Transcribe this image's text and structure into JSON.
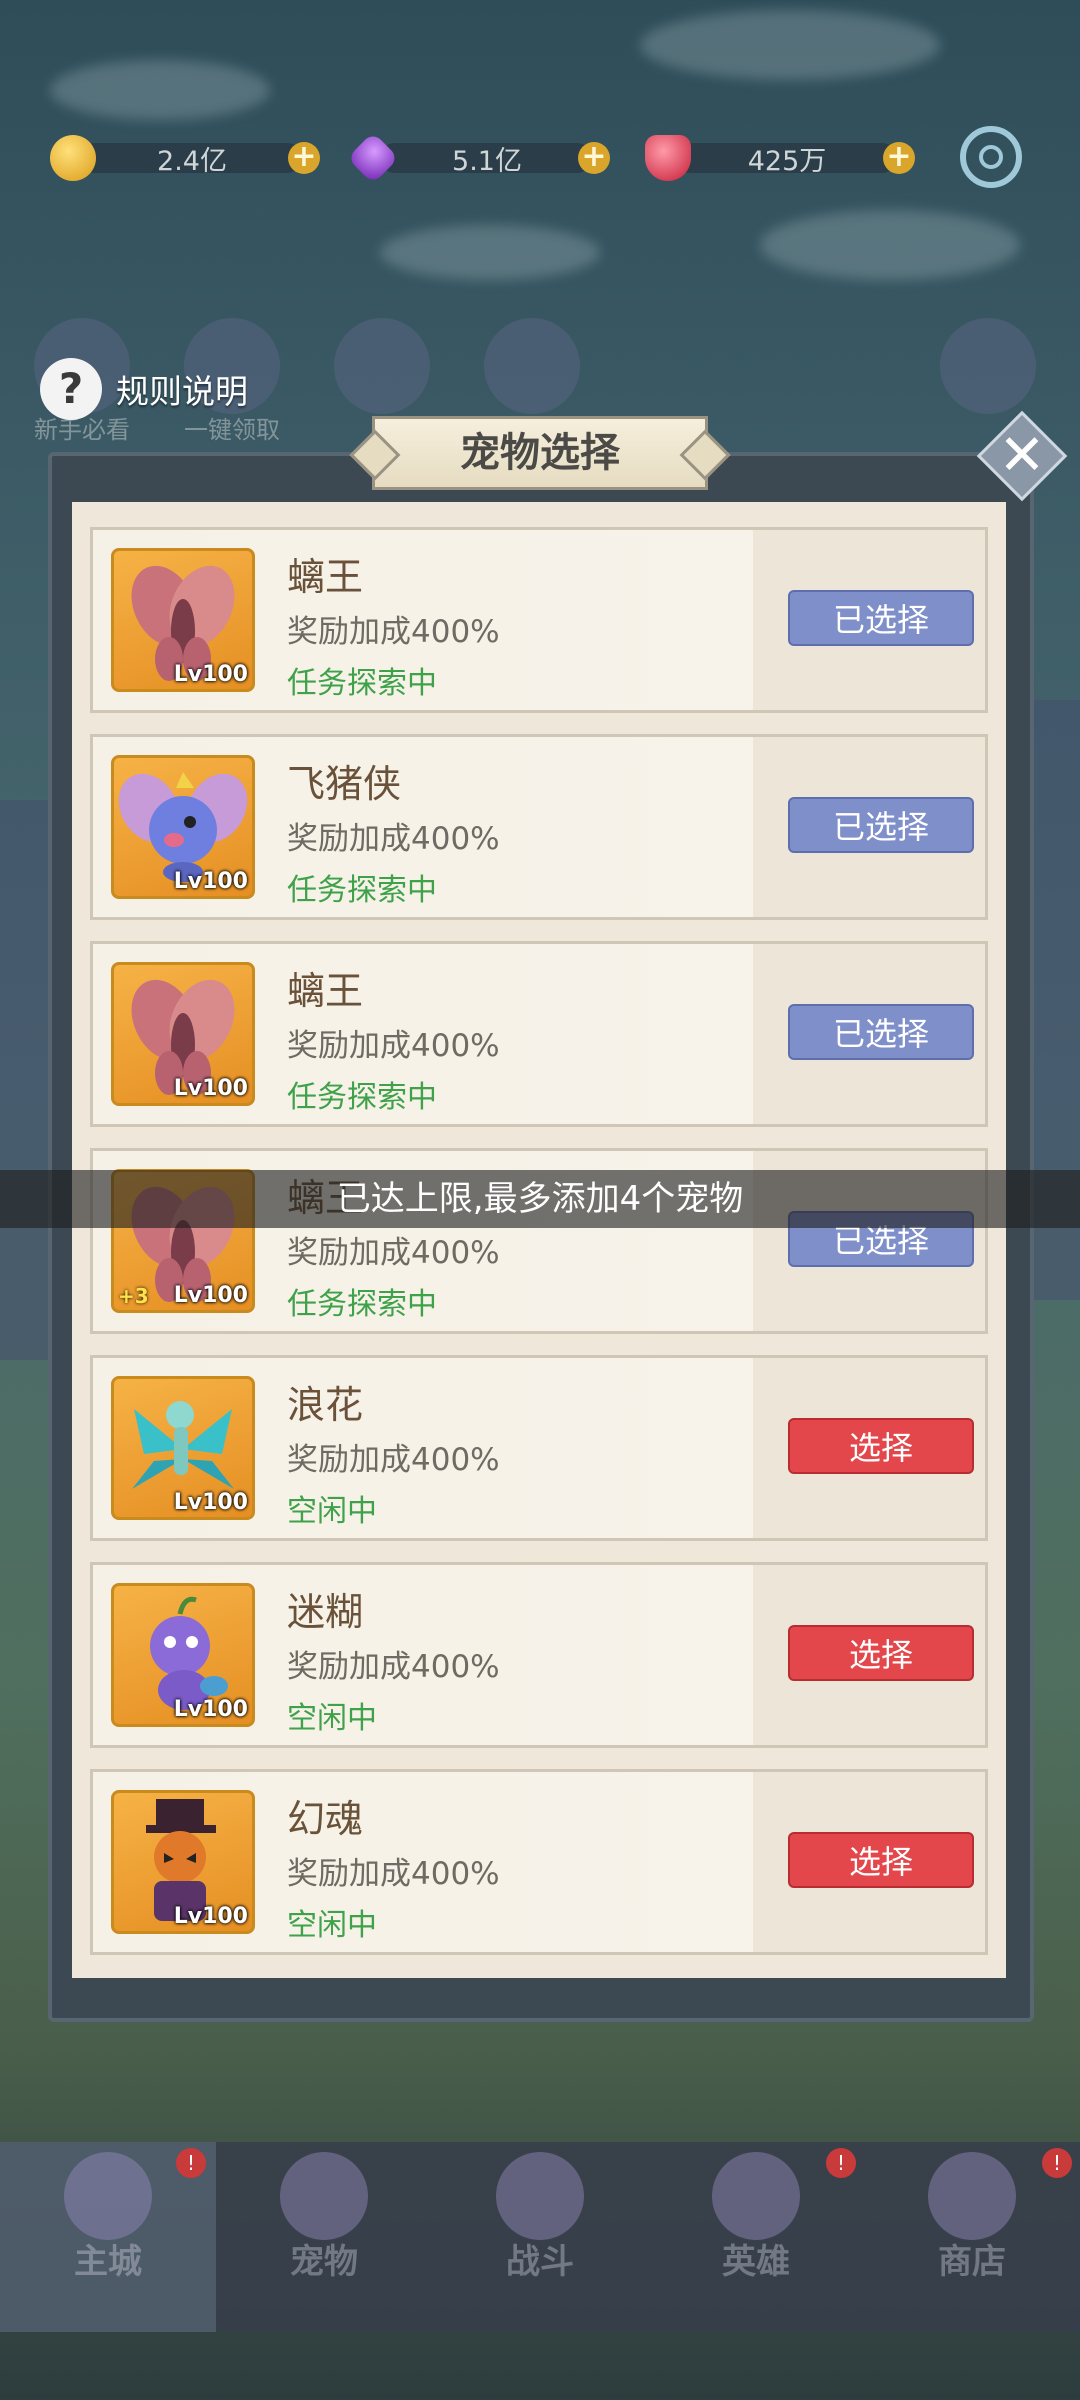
{
  "currency": [
    {
      "icon": "gold-coin-icon",
      "value": "2.4亿",
      "color": "#e6b531"
    },
    {
      "icon": "purple-gem-icon",
      "value": "5.1亿",
      "color": "#8d3bd0"
    },
    {
      "icon": "red-diamond-icon",
      "value": "425万",
      "color": "#e0334b"
    }
  ],
  "shortcuts": [
    "新手必看",
    "一键领取",
    "",
    "",
    ""
  ],
  "rules_label": "规则说明",
  "modal": {
    "title": "宠物选择"
  },
  "pets": [
    {
      "name": "螭王",
      "bonus": "奖励加成400%",
      "status": "任务探索中",
      "level": "Lv100",
      "star": "",
      "button": "已选择",
      "state": "selected"
    },
    {
      "name": "飞猪侠",
      "bonus": "奖励加成400%",
      "status": "任务探索中",
      "level": "Lv100",
      "star": "",
      "button": "已选择",
      "state": "selected"
    },
    {
      "name": "螭王",
      "bonus": "奖励加成400%",
      "status": "任务探索中",
      "level": "Lv100",
      "star": "",
      "button": "已选择",
      "state": "selected"
    },
    {
      "name": "螭王",
      "bonus": "奖励加成400%",
      "status": "任务探索中",
      "level": "Lv100",
      "star": "+3",
      "button": "已选择",
      "state": "selected"
    },
    {
      "name": "浪花",
      "bonus": "奖励加成400%",
      "status": "空闲中",
      "level": "Lv100",
      "star": "",
      "button": "选择",
      "state": "available"
    },
    {
      "name": "迷糊",
      "bonus": "奖励加成400%",
      "status": "空闲中",
      "level": "Lv100",
      "star": "",
      "button": "选择",
      "state": "available"
    },
    {
      "name": "幻魂",
      "bonus": "奖励加成400%",
      "status": "空闲中",
      "level": "Lv100",
      "star": "",
      "button": "选择",
      "state": "available"
    }
  ],
  "toast": "已达上限,最多添加4个宠物",
  "nav": [
    {
      "label": "主城",
      "badge": "!"
    },
    {
      "label": "宠物",
      "badge": ""
    },
    {
      "label": "战斗",
      "badge": ""
    },
    {
      "label": "英雄",
      "badge": "!"
    },
    {
      "label": "商店",
      "badge": "!"
    }
  ],
  "colors": {
    "selected_button": "#7f8fca",
    "select_button": "#e3474b",
    "status_text": "#3fa24a",
    "accent_orange": "#e58f23"
  }
}
